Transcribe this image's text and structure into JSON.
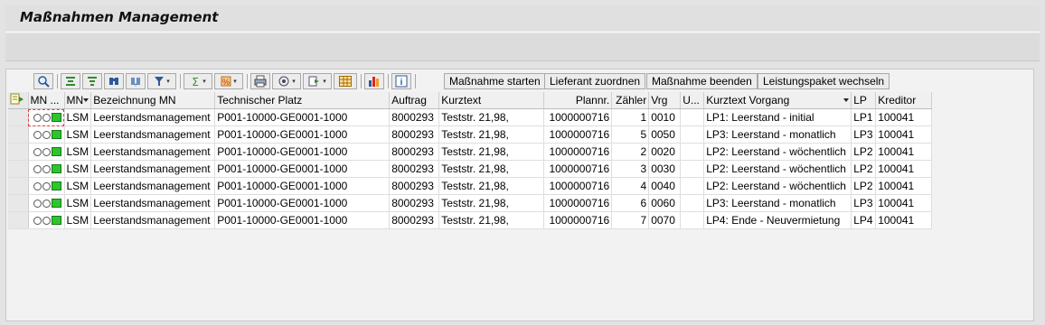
{
  "window": {
    "title": "Maßnahmen Management"
  },
  "toolbar": {
    "buttons": {
      "start": "Maßnahme starten",
      "assign_supplier": "Lieferant zuordnen",
      "end": "Maßnahme beenden",
      "change_package": "Leistungspaket wechseln"
    },
    "icons": [
      "details-icon",
      "sort-ascending-icon",
      "sort-descending-icon",
      "find-icon",
      "find-next-icon",
      "filter-icon",
      "sum-icon",
      "subtotal-icon",
      "print-icon",
      "views-icon",
      "export-icon",
      "layout-icon",
      "graphic-icon",
      "info-icon"
    ]
  },
  "table": {
    "columns": [
      "MN ...",
      "MN",
      "Bezeichnung MN",
      "Technischer Platz",
      "Auftrag",
      "Kurztext",
      "Plannr.",
      "Zähler",
      "Vrg",
      "U...",
      "Kurztext Vorgang",
      "LP",
      "Kreditor"
    ],
    "rows": [
      [
        "",
        "LSM",
        "Leerstandsmanagement",
        "P001-10000-GE0001-1000",
        "8000293",
        "Teststr. 21,98,",
        "1000000716",
        "1",
        "0010",
        "",
        "LP1: Leerstand - initial",
        "LP1",
        "100041"
      ],
      [
        "",
        "LSM",
        "Leerstandsmanagement",
        "P001-10000-GE0001-1000",
        "8000293",
        "Teststr. 21,98,",
        "1000000716",
        "5",
        "0050",
        "",
        "LP3: Leerstand - monatlich",
        "LP3",
        "100041"
      ],
      [
        "",
        "LSM",
        "Leerstandsmanagement",
        "P001-10000-GE0001-1000",
        "8000293",
        "Teststr. 21,98,",
        "1000000716",
        "2",
        "0020",
        "",
        "LP2: Leerstand - wöchentlich",
        "LP2",
        "100041"
      ],
      [
        "",
        "LSM",
        "Leerstandsmanagement",
        "P001-10000-GE0001-1000",
        "8000293",
        "Teststr. 21,98,",
        "1000000716",
        "3",
        "0030",
        "",
        "LP2: Leerstand - wöchentlich",
        "LP2",
        "100041"
      ],
      [
        "",
        "LSM",
        "Leerstandsmanagement",
        "P001-10000-GE0001-1000",
        "8000293",
        "Teststr. 21,98,",
        "1000000716",
        "4",
        "0040",
        "",
        "LP2: Leerstand - wöchentlich",
        "LP2",
        "100041"
      ],
      [
        "",
        "LSM",
        "Leerstandsmanagement",
        "P001-10000-GE0001-1000",
        "8000293",
        "Teststr. 21,98,",
        "1000000716",
        "6",
        "0060",
        "",
        "LP3: Leerstand - monatlich",
        "LP3",
        "100041"
      ],
      [
        "",
        "LSM",
        "Leerstandsmanagement",
        "P001-10000-GE0001-1000",
        "8000293",
        "Teststr. 21,98,",
        "1000000716",
        "7",
        "0070",
        "",
        "LP4: Ende - Neuvermietung",
        "LP4",
        "100041"
      ]
    ],
    "status_lights": "green",
    "colors": {
      "light_on": "#2ec42e"
    }
  }
}
